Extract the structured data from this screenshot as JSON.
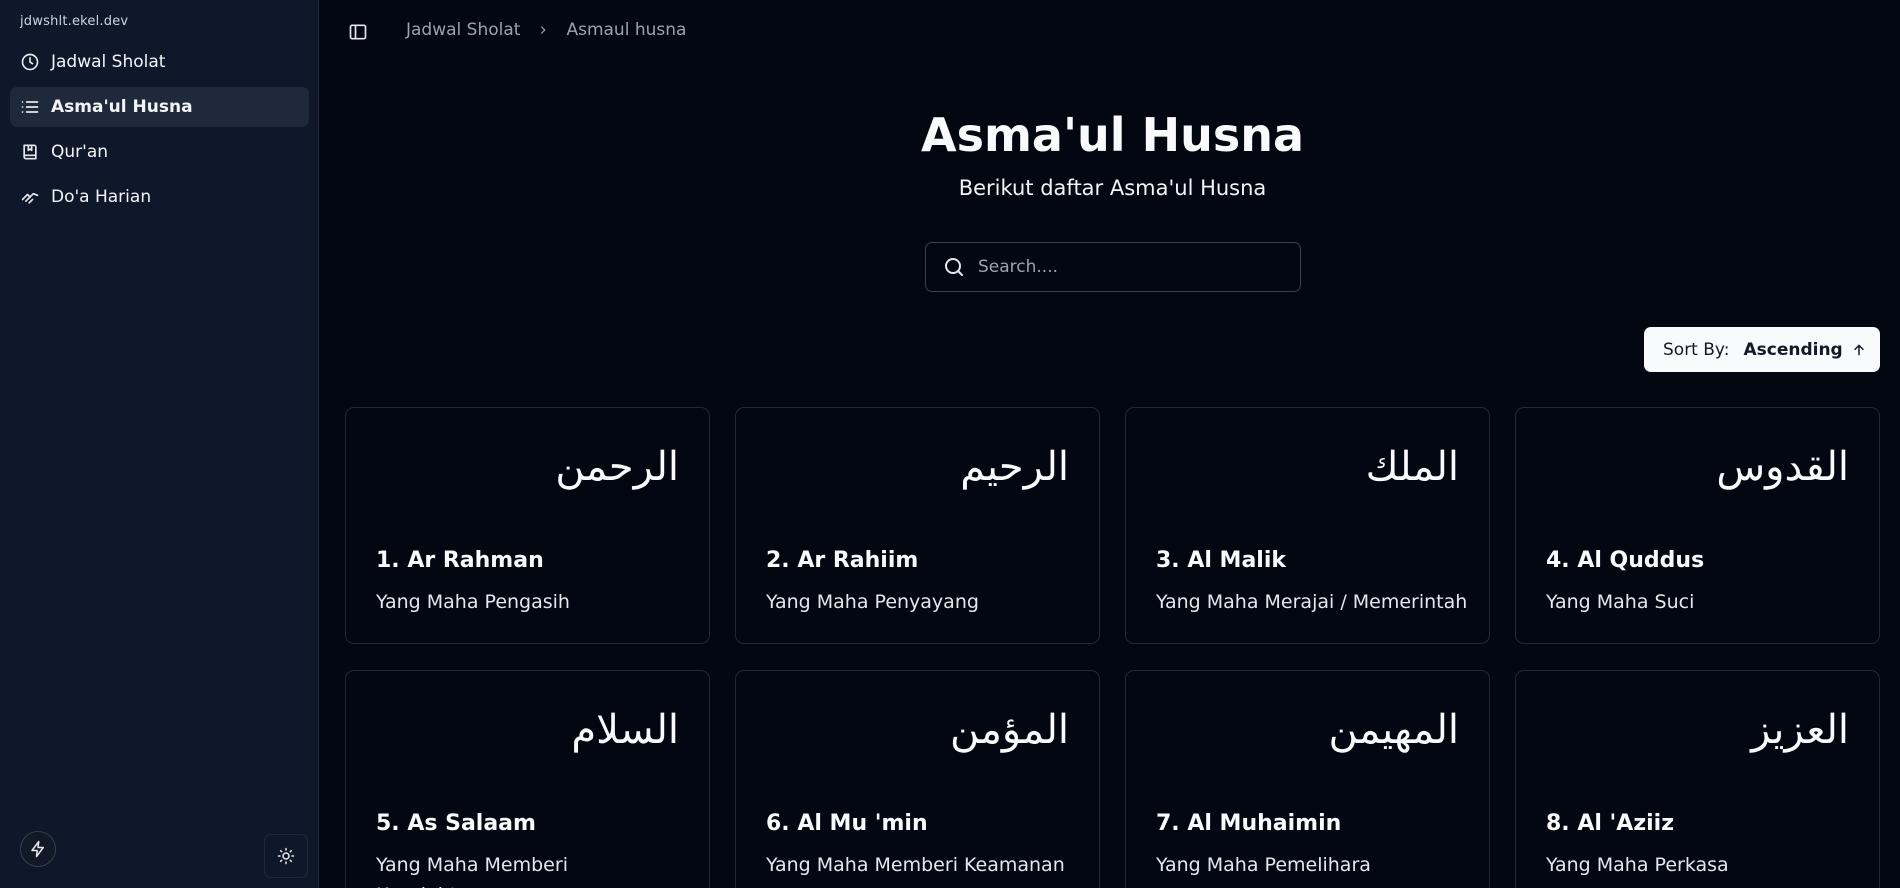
{
  "sidebar": {
    "site_name": "jdwshlt.ekel.dev",
    "items": [
      {
        "label": "Jadwal Sholat",
        "icon": "clock-icon"
      },
      {
        "label": "Asma'ul Husna",
        "icon": "list-icon"
      },
      {
        "label": "Qur'an",
        "icon": "book-icon"
      },
      {
        "label": "Do'a Harian",
        "icon": "praying-hands-icon"
      }
    ],
    "active_index": 1
  },
  "header": {
    "breadcrumb": [
      "Jadwal Sholat",
      "Asmaul husna"
    ]
  },
  "main": {
    "title": "Asma'ul Husna",
    "subtitle": "Berikut daftar Asma'ul Husna",
    "search": {
      "placeholder": "Search...."
    },
    "sort": {
      "label": "Sort By:",
      "value": "Ascending"
    },
    "cards": [
      {
        "arabic": "الرحمن",
        "name": "1. Ar Rahman",
        "meaning": "Yang Maha Pengasih"
      },
      {
        "arabic": "الرحيم",
        "name": "2. Ar Rahiim",
        "meaning": "Yang Maha Penyayang"
      },
      {
        "arabic": "الملك",
        "name": "3. Al Malik",
        "meaning": "Yang Maha Merajai / Memerintah"
      },
      {
        "arabic": "القدوس",
        "name": "4. Al Quddus",
        "meaning": "Yang Maha Suci"
      },
      {
        "arabic": "السلام",
        "name": "5. As Salaam",
        "meaning": "Yang Maha Memberi Kesejahteraan"
      },
      {
        "arabic": "المؤمن",
        "name": "6. Al Mu 'min",
        "meaning": "Yang Maha Memberi Keamanan"
      },
      {
        "arabic": "المهيمن",
        "name": "7. Al Muhaimin",
        "meaning": "Yang Maha Pemelihara"
      },
      {
        "arabic": "العزيز",
        "name": "8. Al 'Aziiz",
        "meaning": "Yang Maha Perkasa"
      }
    ]
  },
  "colors": {
    "background": "#030712",
    "sidebar": "#0f172a",
    "active_item": "#1e293b",
    "border": "#1f2937",
    "sort_button": "#f9fafb"
  }
}
